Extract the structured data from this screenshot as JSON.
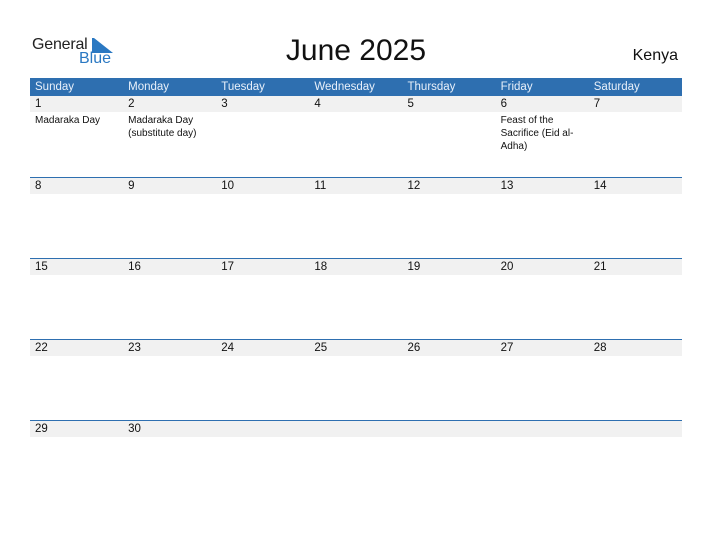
{
  "logo": {
    "line1": "General",
    "line2": "Blue"
  },
  "title": "June 2025",
  "country": "Kenya",
  "colors": {
    "header_bg": "#2e6fb0",
    "date_bar_bg": "#f1f1f1",
    "logo_blue": "#2a78c2"
  },
  "weekdays": [
    "Sunday",
    "Monday",
    "Tuesday",
    "Wednesday",
    "Thursday",
    "Friday",
    "Saturday"
  ],
  "weeks": [
    {
      "days": [
        "1",
        "2",
        "3",
        "4",
        "5",
        "6",
        "7"
      ],
      "events": [
        "Madaraka Day",
        "Madaraka Day (substitute day)",
        "",
        "",
        "",
        "Feast of the Sacrifice (Eid al-Adha)",
        ""
      ]
    },
    {
      "days": [
        "8",
        "9",
        "10",
        "11",
        "12",
        "13",
        "14"
      ],
      "events": [
        "",
        "",
        "",
        "",
        "",
        "",
        ""
      ]
    },
    {
      "days": [
        "15",
        "16",
        "17",
        "18",
        "19",
        "20",
        "21"
      ],
      "events": [
        "",
        "",
        "",
        "",
        "",
        "",
        ""
      ]
    },
    {
      "days": [
        "22",
        "23",
        "24",
        "25",
        "26",
        "27",
        "28"
      ],
      "events": [
        "",
        "",
        "",
        "",
        "",
        "",
        ""
      ]
    },
    {
      "days": [
        "29",
        "30",
        "",
        "",
        "",
        "",
        ""
      ],
      "events": [
        "",
        "",
        "",
        "",
        "",
        "",
        ""
      ]
    }
  ]
}
